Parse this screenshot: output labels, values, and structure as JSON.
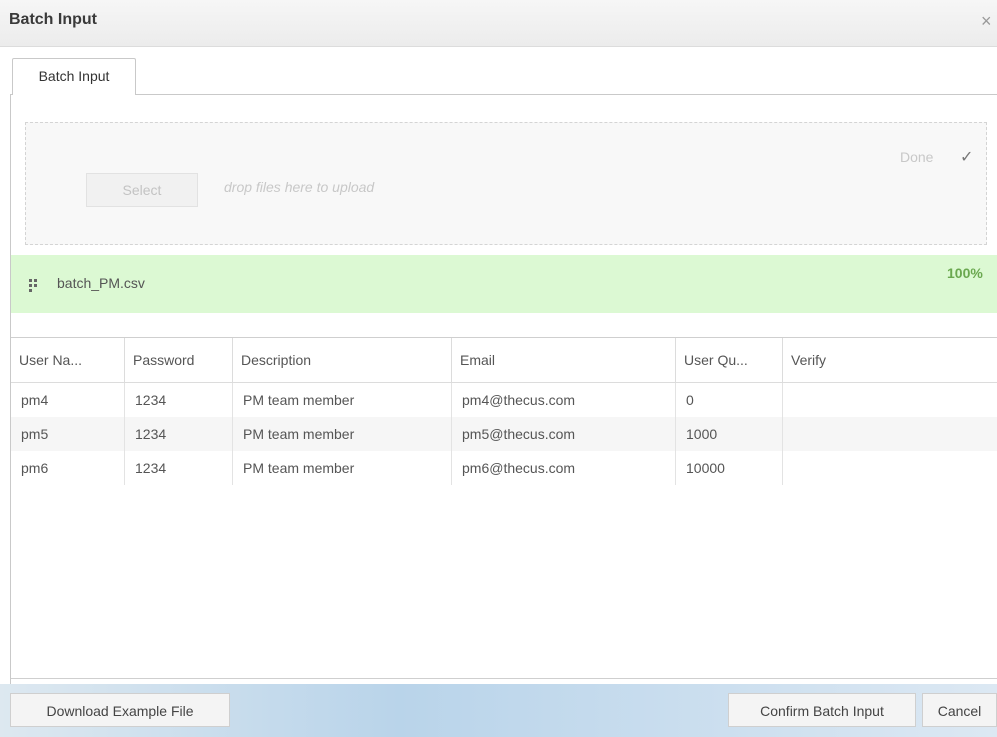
{
  "window": {
    "title": "Batch Input",
    "close_glyph": "×"
  },
  "tabs": [
    {
      "label": "Batch Input"
    }
  ],
  "upload": {
    "select_label": "Select",
    "drop_hint": "drop files here to upload",
    "status_label": "Done",
    "status_icon": "✓"
  },
  "file": {
    "name": "batch_PM.csv",
    "progress_label": "100%",
    "progress": 1.0
  },
  "table": {
    "columns": [
      "User Na...",
      "Password",
      "Description",
      "Email",
      "User Qu...",
      "Verify"
    ],
    "rows": [
      [
        "pm4",
        "1234",
        "PM team member",
        "pm4@thecus.com",
        "0",
        ""
      ],
      [
        "pm5",
        "1234",
        "PM team member",
        "pm5@thecus.com",
        "1000",
        ""
      ],
      [
        "pm6",
        "1234",
        "PM team member",
        "pm6@thecus.com",
        "10000",
        ""
      ]
    ]
  },
  "footer": {
    "download_label": "Download Example File",
    "confirm_label": "Confirm Batch Input",
    "cancel_label": "Cancel"
  },
  "colors": {
    "progress_bg": "#dcf9d3",
    "progress_text": "#6aa84f"
  }
}
